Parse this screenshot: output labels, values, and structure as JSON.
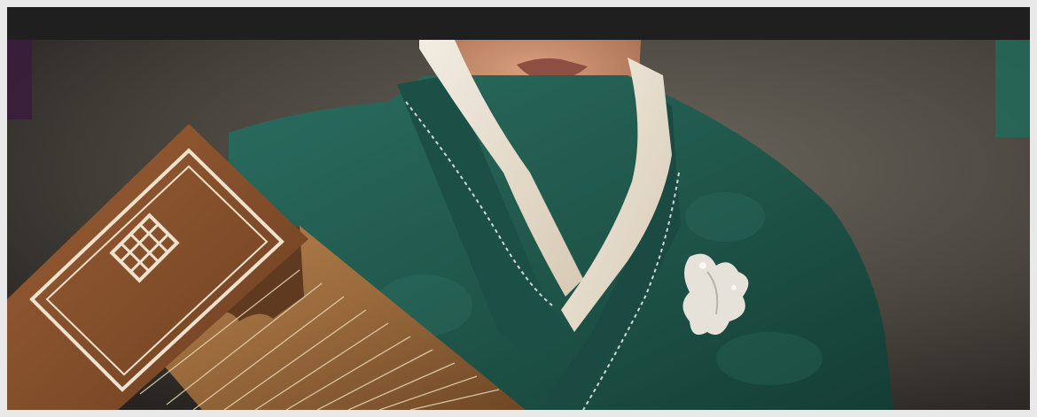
{
  "image": {
    "colors": {
      "outer_border": "#e9e9e9",
      "top_bar": "#1f1f1f",
      "background": "#4a463f",
      "robe": "#1f5549",
      "collar": "#e8ddc8",
      "stitching": "#cfd8d4",
      "instrument_wood": "#9a6a3c",
      "instrument_head": "#7d4a2a",
      "brooch": "#e6e2da",
      "skin": "#c98e6e"
    }
  }
}
